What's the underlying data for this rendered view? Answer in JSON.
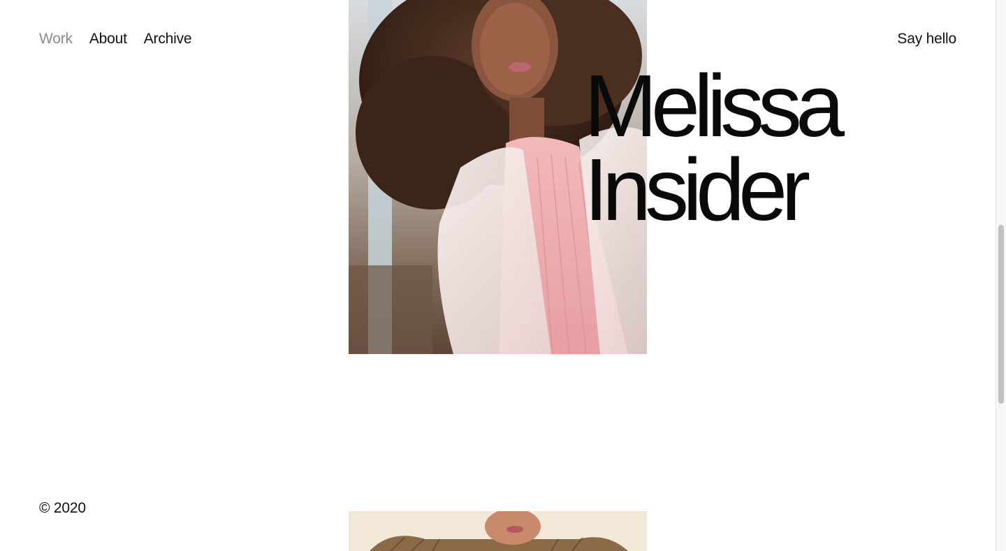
{
  "nav": {
    "items": [
      {
        "label": "Work",
        "active": true
      },
      {
        "label": "About",
        "active": false
      },
      {
        "label": "Archive",
        "active": false
      }
    ],
    "contact_label": "Say hello"
  },
  "project": {
    "title_line1": "Melissa",
    "title_line2": "Insider"
  },
  "footer": {
    "copyright": "© 2020"
  },
  "colors": {
    "text": "#111111",
    "nav_active": "#8a8a8a",
    "background": "#ffffff",
    "top_pink": "#e9a7aa"
  }
}
